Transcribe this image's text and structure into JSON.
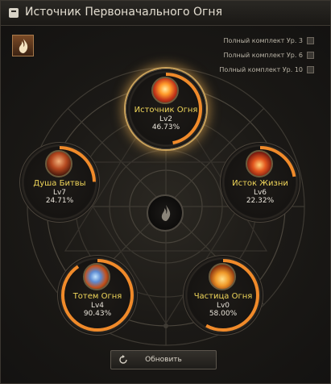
{
  "window": {
    "title": "Источник Первоначального Огня"
  },
  "set_bonuses": [
    {
      "label": "Полный комплект Ур. 3",
      "checked": false
    },
    {
      "label": "Полный комплект Ур. 6",
      "checked": false
    },
    {
      "label": "Полный комплект Ур. 10",
      "checked": false
    }
  ],
  "nodes": {
    "source": {
      "name": "Источник Огня",
      "level": "Lv2",
      "progress_text": "46.73%",
      "progress": 46.73,
      "active": true
    },
    "battle_soul": {
      "name": "Душа Битвы",
      "level": "Lv7",
      "progress_text": "24.71%",
      "progress": 24.71,
      "active": false
    },
    "life_source": {
      "name": "Исток Жизни",
      "level": "Lv6",
      "progress_text": "22.32%",
      "progress": 22.32,
      "active": false
    },
    "fire_totem": {
      "name": "Тотем Огня",
      "level": "Lv4",
      "progress_text": "90.43%",
      "progress": 90.43,
      "active": false
    },
    "fire_particle": {
      "name": "Частица Огня",
      "level": "Lv0",
      "progress_text": "58.00%",
      "progress": 58.0,
      "active": false
    }
  },
  "footer": {
    "refresh_label": "Обновить"
  },
  "colors": {
    "node_name": "#f0d65a",
    "progress_arc": "#f08a2a",
    "active_glow": "#caa25b"
  },
  "icons": {
    "emblem": "flame-emblem-icon",
    "center": "flame-center-icon",
    "refresh": "refresh-icon"
  }
}
